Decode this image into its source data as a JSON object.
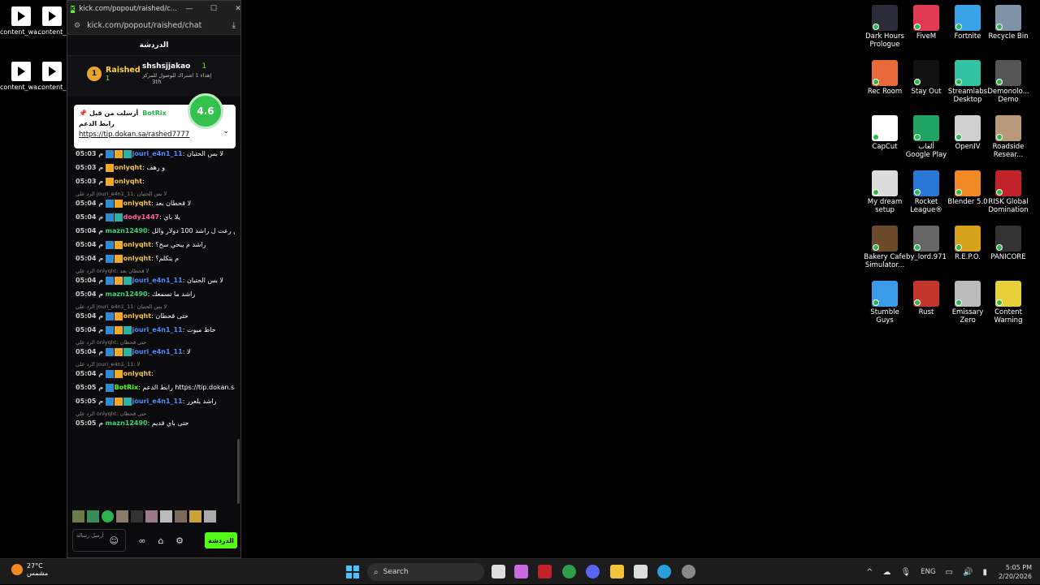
{
  "desktop_left": [
    {
      "label": "content_wa..."
    },
    {
      "label": "content_"
    },
    {
      "label": "content_wa..."
    },
    {
      "label": "content_"
    }
  ],
  "desktop_right": [
    {
      "label": "Dark Hours Prologue",
      "color": "#2b2b3a"
    },
    {
      "label": "FiveM",
      "color": "#e03a55"
    },
    {
      "label": "Fortnite",
      "color": "#3aa3e8"
    },
    {
      "label": "Recycle Bin",
      "color": "#7e93a8"
    },
    {
      "label": "Rec Room",
      "color": "#e86a3a"
    },
    {
      "label": "Stay Out",
      "color": "#111111"
    },
    {
      "label": "Streamlabs Desktop",
      "color": "#31c3a2"
    },
    {
      "label": "Demonolo... Demo",
      "color": "#555555"
    },
    {
      "label": "CapCut",
      "color": "#ffffff"
    },
    {
      "label": "ألعاب Google Play",
      "color": "#1fa463"
    },
    {
      "label": "OpenIV",
      "color": "#cfcfcf"
    },
    {
      "label": "Roadside Resear...",
      "color": "#b89a7a"
    },
    {
      "label": "My dream setup",
      "color": "#dcdcdc"
    },
    {
      "label": "Rocket League®",
      "color": "#2a78d6"
    },
    {
      "label": "Blender 5.0",
      "color": "#f08a24"
    },
    {
      "label": "RISK Global Domination",
      "color": "#c2232b"
    },
    {
      "label": "Bakery Cafe Simulator...",
      "color": "#6b4a2a"
    },
    {
      "label": "by_lord.971",
      "color": "#666666"
    },
    {
      "label": "R.E.P.O.",
      "color": "#d8a21a"
    },
    {
      "label": "PANICORE",
      "color": "#333333"
    },
    {
      "label": "Stumble Guys",
      "color": "#3a9be8"
    },
    {
      "label": "Rust",
      "color": "#c2362b"
    },
    {
      "label": "Emissary Zero",
      "color": "#bbbbbb"
    },
    {
      "label": "Content Warning",
      "color": "#e8d03a"
    }
  ],
  "window": {
    "title": "kick.com/popout/raished/c...",
    "url": "kick.com/popout/raished/chat",
    "chat_header": "الدردشة"
  },
  "leaderboard": {
    "first": {
      "rank": "1",
      "name": "Raished",
      "count": "1"
    },
    "second": {
      "name": "shshsjjakao",
      "count": "1",
      "sub": "إهداء 1 اشتراك للوصول للمركز",
      "rank": "3th"
    }
  },
  "pinned": {
    "label": "أرسلت من قبل",
    "bot": "BotRix",
    "text": "رابط الدعم",
    "link": "https://tip.dokan.sa/rashed7777",
    "rating": "4.6"
  },
  "messages": [
    {
      "reply": "",
      "time": "05:03 م",
      "user": "jouri_e4n1_11",
      "ucolor": "#4f8dff",
      "text": "لا بس الحتبان",
      "badges": "bcg"
    },
    {
      "reply": "",
      "time": "05:03 م",
      "user": "onlyqht",
      "ucolor": "#f6c343",
      "text": "و رهف",
      "badges": "c"
    },
    {
      "reply": "",
      "time": "05:03 م",
      "user": "onlyqht",
      "ucolor": "#f6c343",
      "text": "",
      "badges": "c"
    },
    {
      "reply": "الرد على jouri_e4n1_11: لا بس الحتبان",
      "time": "05:04 م",
      "user": "onlyqht",
      "ucolor": "#f6c343",
      "text": "لا قحطان بعد",
      "badges": "bc"
    },
    {
      "reply": "",
      "time": "05:04 م",
      "user": "dody1447",
      "ucolor": "#ff5fa2",
      "text": "يلا باي",
      "badges": "bg"
    },
    {
      "reply": "",
      "time": "05:04 م",
      "user": "mazn12490",
      "ucolor": "#36d47a",
      "text": "تحيل تحيل عن رعت ل راشد 100 دولار والل",
      "badges": ""
    },
    {
      "reply": "",
      "time": "05:04 م",
      "user": "onlyqht",
      "ucolor": "#f6c343",
      "text": "راشد م يبحي سح؟",
      "badges": "bc"
    },
    {
      "reply": "",
      "time": "05:04 م",
      "user": "onlyqht",
      "ucolor": "#f6c343",
      "text": "م يتكلم؟",
      "badges": "bc"
    },
    {
      "reply": "الرد على onlyqht: لا قحطان بعد",
      "time": "05:04 م",
      "user": "jouri_e4n1_11",
      "ucolor": "#4f8dff",
      "text": "لا بس الحتبان",
      "badges": "bcg"
    },
    {
      "reply": "",
      "time": "05:04 م",
      "user": "mazn12490",
      "ucolor": "#36d47a",
      "text": "راشد ما تسمعك",
      "badges": ""
    },
    {
      "reply": "الرد على jouri_e4n1_11: لا بس الحتبان",
      "time": "05:04 م",
      "user": "onlyqht",
      "ucolor": "#f6c343",
      "text": "حتى قحطان",
      "badges": "bc"
    },
    {
      "reply": "",
      "time": "05:04 م",
      "user": "jouri_e4n1_11",
      "ucolor": "#4f8dff",
      "text": "حاط ميوت",
      "badges": "bcg"
    },
    {
      "reply": "الرد على onlyqht: حتى قحطان",
      "time": "05:04 م",
      "user": "jouri_e4n1_11",
      "ucolor": "#4f8dff",
      "text": "لا",
      "badges": "bcg"
    },
    {
      "reply": "الرد على jouri_e4n1_11: لا",
      "time": "05:04 م",
      "user": "onlyqht",
      "ucolor": "#f6c343",
      "text": "",
      "badges": "bc"
    },
    {
      "reply": "",
      "time": "05:05 م",
      "user": "BotRix",
      "ucolor": "#53fc18",
      "text": "رابط الدعم https://tip.dokan.sa/rashed7777",
      "badges": "b"
    },
    {
      "reply": "",
      "time": "05:05 م",
      "user": "jouri_e4n1_11",
      "ucolor": "#4f8dff",
      "text": "راشد يلعرر",
      "badges": "bcg"
    },
    {
      "reply": "الرد على onlyqht: حتى قحطان",
      "time": "05:05 م",
      "user": "mazn12490",
      "ucolor": "#36d47a",
      "text": "حتى باي قديم",
      "badges": ""
    }
  ],
  "input": {
    "placeholder": "أرسل رسالة",
    "send_label": "الدردشة"
  },
  "taskbar": {
    "temp": "27°C",
    "weather": "مشمس",
    "search": "Search",
    "lang": "ENG",
    "time": "5:05 PM",
    "date": "2/20/2026"
  }
}
